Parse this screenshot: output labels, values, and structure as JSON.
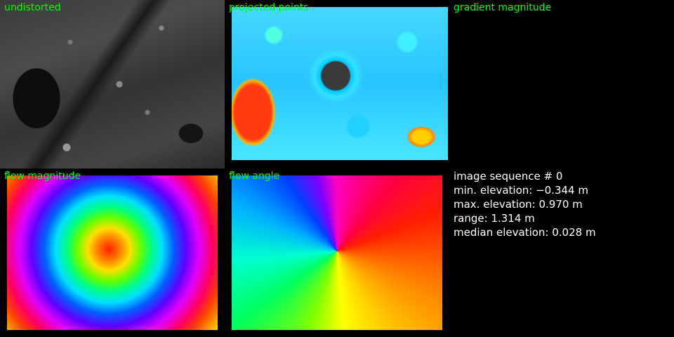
{
  "panels": {
    "undistorted": "undistorted",
    "projected_points": "projected points",
    "gradient_magnitude": "gradient magnitude",
    "flow_magnitude": "flow magnitude",
    "flow_angle": "flow angle"
  },
  "stats": {
    "sequence": "image sequence # 0",
    "min_elevation": "min. elevation: −0.344 m",
    "max_elevation": "max. elevation: 0.970 m",
    "range": "range: 1.314 m",
    "median_elevation": "median elevation: 0.028 m"
  },
  "colors": {
    "label": "#00ff00",
    "stats_text": "#ffffff",
    "background": "#000000"
  }
}
